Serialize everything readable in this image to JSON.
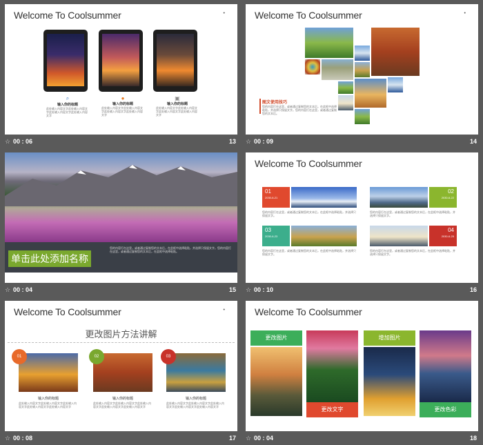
{
  "slides": [
    {
      "title": "Welcome To Coolsummer",
      "time": "00 : 06",
      "number": "13",
      "corner_mark": "•",
      "items": [
        {
          "icon": "search-icon",
          "heading": "输入你的标题",
          "text": "此处输入内容文字此处输入内容文字此处输入内容文字此处输入内容文字"
        },
        {
          "icon": "chat-icon",
          "heading": "输入你的标题",
          "text": "此处输入内容文字此处输入内容文字此处输入内容文字此处输入内容文字"
        },
        {
          "icon": "lock-icon",
          "heading": "输入你的标题",
          "text": "此处输入内容文字此处输入内容文字此处输入内容文字此处输入内容文字"
        }
      ]
    },
    {
      "title": "Welcome To Coolsummer",
      "time": "00 : 09",
      "number": "14",
      "corner_mark": "•",
      "caption_heading": "图文使用技巧",
      "caption_text": "您的内容打在这里，或者通过复制您的文本后，在此框中选择粘贴，并选择只保留文字。您的内容打在这里，或者通过复制您的文本后。"
    },
    {
      "time": "00 : 04",
      "number": "15",
      "banner_title": "单击此处添加名称",
      "banner_text": "您的内容打在这里，或者通过复制您的文本后，在此框中选择粘贴，并选择只保留文字。您的内容打在这里，或者通过复制您的文本后，在此框中选择粘贴。"
    },
    {
      "title": "Welcome To Coolsummer",
      "time": "00 : 10",
      "number": "16",
      "cards": [
        {
          "num": "01",
          "date": "2030-6-21",
          "color": "#e0492e",
          "text": "您的内容打在这里，或者通过复制您的文本后，在此框中选择粘贴，并选择只保留文字。"
        },
        {
          "num": "02",
          "date": "2030-6-22",
          "color": "#8bb62e",
          "text": "您的内容打在这里，或者通过复制您的文本后，在此框中选择粘贴，并选择只保留文字。"
        },
        {
          "num": "03",
          "date": "2030-6-23",
          "color": "#3cae8c",
          "text": "您的内容打在这里，或者通过复制您的文本后，在此框中选择粘贴，并选择只保留文字。"
        },
        {
          "num": "04",
          "date": "2030-6-25",
          "color": "#c8322a",
          "text": "您的内容打在这里，或者通过复制您的文本后，在此框中选择粘贴，并选择只保留文字。"
        }
      ]
    },
    {
      "title": "Welcome To Coolsummer",
      "time": "00 : 08",
      "number": "17",
      "corner_mark": "•",
      "subtitle": "更改图片方法讲解",
      "items": [
        {
          "num": "01",
          "color": "#e86a2a",
          "heading": "输入你的标题",
          "text": "此处输入内容文字此处输入内容文字此处输入内容文字此处输入内容文字此处输入内容文字"
        },
        {
          "num": "02",
          "color": "#7aa82e",
          "heading": "输入你的标题",
          "text": "此处输入内容文字此处输入内容文字此处输入内容文字此处输入内容文字此处输入内容文字"
        },
        {
          "num": "03",
          "color": "#c8322a",
          "heading": "输入你的标题",
          "text": "此处输入内容文字此处输入内容文字此处输入内容文字此处输入内容文字此处输入内容文字"
        }
      ]
    },
    {
      "title": "Welcome To Coolsummer",
      "time": "00 : 04",
      "number": "18",
      "labels": {
        "change_image": "更改图片",
        "change_text": "更改文字",
        "add_image": "增加图片",
        "change_color": "更改色彩"
      },
      "colors": {
        "green": "#3cae5a",
        "red": "#e0492e",
        "lime": "#8bb62e"
      }
    }
  ],
  "star_glyph": "☆"
}
